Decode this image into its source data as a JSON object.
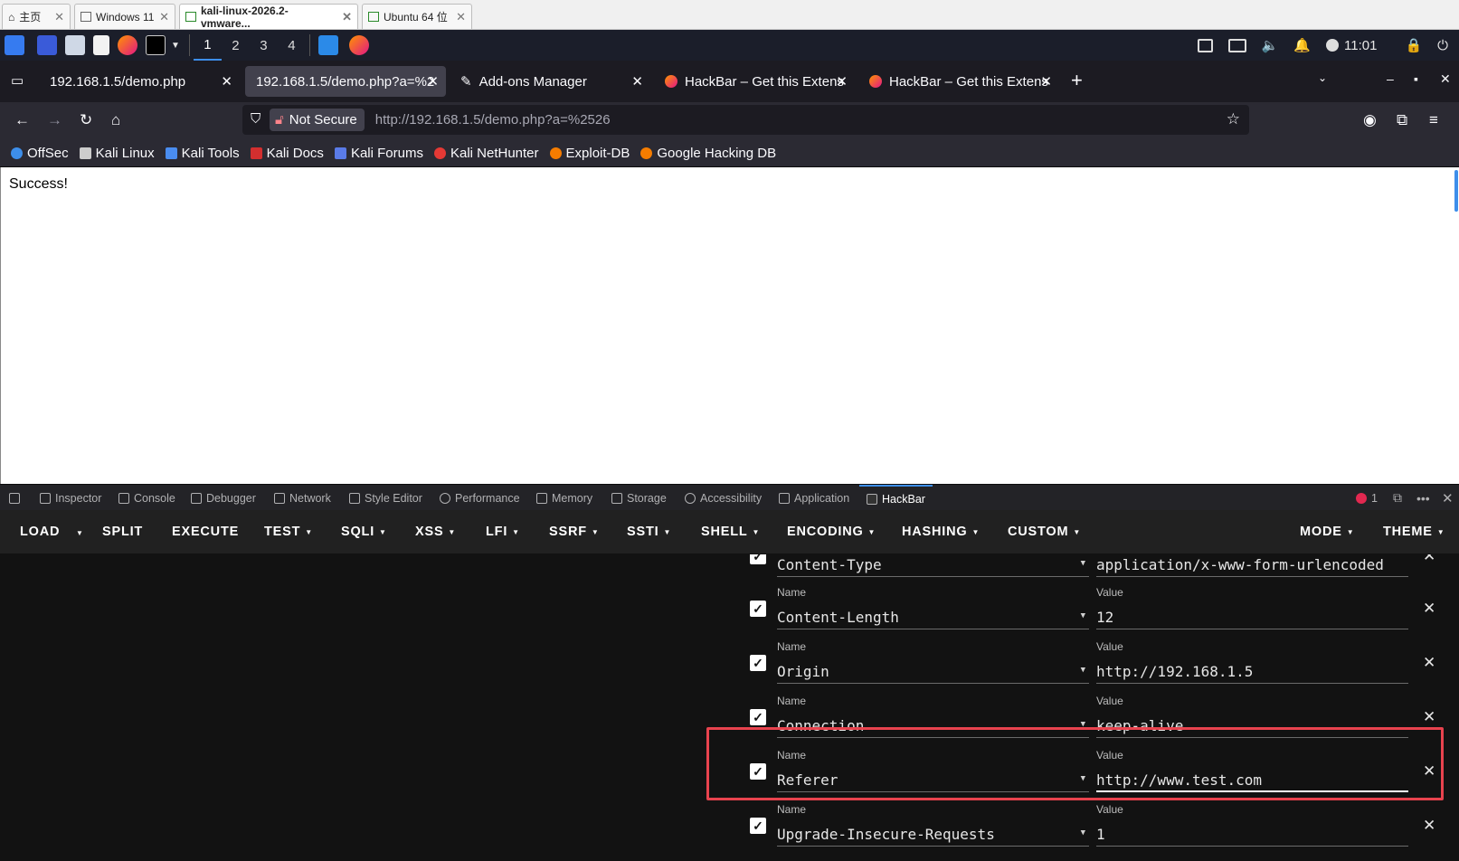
{
  "vm_tabs": [
    {
      "label": "主页",
      "icon": "home-icon"
    },
    {
      "label": "Windows 11",
      "icon": "vm-icon"
    },
    {
      "label": "kali-linux-2026.2-vmware...",
      "icon": "vm-running-icon",
      "active": true
    },
    {
      "label": "Ubuntu 64 位",
      "icon": "vm-running-icon"
    }
  ],
  "kali_panel": {
    "workspaces": [
      "1",
      "2",
      "3",
      "4"
    ],
    "active_workspace": "1",
    "clock": "11:01"
  },
  "browser_tabs": [
    {
      "title": "192.168.1.5/demo.php",
      "close": "✕"
    },
    {
      "title": "192.168.1.5/demo.php?a=%2",
      "close": "✕",
      "active": true
    },
    {
      "title": "Add-ons Manager",
      "close": "✕"
    },
    {
      "title": "HackBar – Get this Extens",
      "close": "✕"
    },
    {
      "title": "HackBar – Get this Extens",
      "close": "✕"
    }
  ],
  "new_tab_label": "+",
  "nav": {
    "security_label": "Not Secure",
    "url": "http://192.168.1.5/demo.php?a=%2526"
  },
  "bookmarks": [
    "OffSec",
    "Kali Linux",
    "Kali Tools",
    "Kali Docs",
    "Kali Forums",
    "Kali NetHunter",
    "Exploit-DB",
    "Google Hacking DB"
  ],
  "page": {
    "text": "Success!"
  },
  "devtools": {
    "tabs": [
      "Inspector",
      "Console",
      "Debugger",
      "Network",
      "Style Editor",
      "Performance",
      "Memory",
      "Storage",
      "Accessibility",
      "Application",
      "HackBar"
    ],
    "active_tab": "HackBar",
    "error_count": "1"
  },
  "hackbar": {
    "menu": [
      "LOAD",
      "SPLIT",
      "EXECUTE",
      "TEST",
      "SQLI",
      "XSS",
      "LFI",
      "SSRF",
      "SSTI",
      "SHELL",
      "ENCODING",
      "HASHING",
      "CUSTOM",
      "MODE",
      "THEME"
    ],
    "name_label": "Name",
    "value_label": "Value",
    "headers": [
      {
        "name": "Content-Type",
        "value": "application/x-www-form-urlencoded",
        "enabled": true
      },
      {
        "name": "Content-Length",
        "value": "12",
        "enabled": true
      },
      {
        "name": "Origin",
        "value": "http://192.168.1.5",
        "enabled": true
      },
      {
        "name": "Connection",
        "value": "keep-alive",
        "enabled": true
      },
      {
        "name": "Referer",
        "value": "http://www.test.com",
        "enabled": true,
        "highlighted": true
      },
      {
        "name": "Upgrade-Insecure-Requests",
        "value": "1",
        "enabled": true
      }
    ]
  },
  "colors": {
    "highlight": "#e8434e",
    "accent": "#3d8eea",
    "hackbar_bg": "#121212"
  }
}
